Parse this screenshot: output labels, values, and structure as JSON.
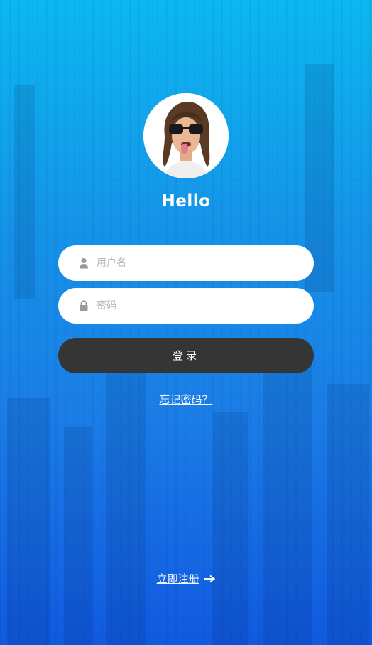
{
  "header": {
    "title": "Hello"
  },
  "form": {
    "username_placeholder": "用户名",
    "password_placeholder": "密码",
    "username_icon": "user-icon",
    "password_icon": "lock-icon"
  },
  "actions": {
    "login_label": "登录",
    "forgot_label": "忘记密码？",
    "register_label": "立即注册",
    "register_icon": "arrow-right-icon"
  },
  "colors": {
    "background_top": "#0bb8f0",
    "background_bottom": "#1059e0",
    "login_button": "#353535",
    "field_background": "#ffffff",
    "icon_gray": "#9a9a9a"
  }
}
